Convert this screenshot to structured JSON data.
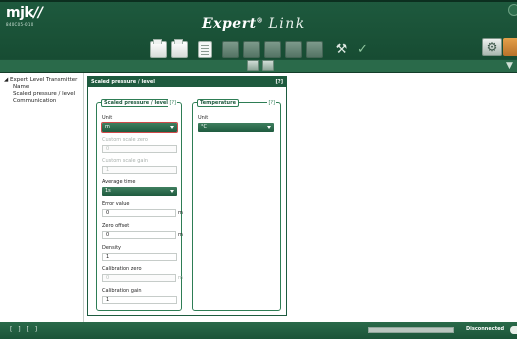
{
  "app": {
    "logo_text": "mjk",
    "logo_sub": "840C05-010",
    "title_main": "Expert",
    "title_sup": "®",
    "title_link": "Link"
  },
  "nav": {
    "root": "Expert Level Transmitter",
    "items": [
      "Name",
      "Scaled pressure / level",
      "Communication"
    ]
  },
  "panel": {
    "title": "Scaled pressure / level",
    "help": "[?]"
  },
  "scaled": {
    "group_title": "Scaled pressure / level",
    "help": "[?]",
    "unit_label": "Unit",
    "unit_value": "m",
    "custom_zero_label": "Custom scale zero",
    "custom_zero_value": "0",
    "custom_gain_label": "Custom scale gain",
    "custom_gain_value": "1",
    "avg_label": "Average time",
    "avg_value": "1s",
    "error_label": "Error value",
    "error_value": "0",
    "error_unit": "m",
    "zero_label": "Zero offset",
    "zero_value": "0",
    "zero_unit": "m",
    "density_label": "Density",
    "density_value": "1",
    "cal_zero_label": "Calibration zero",
    "cal_zero_value": "0",
    "cal_zero_unit": "m",
    "cal_gain_label": "Calibration gain",
    "cal_gain_value": "1"
  },
  "temperature": {
    "group_title": "Temperature",
    "help": "[?]",
    "unit_label": "Unit",
    "unit_value": "°C"
  },
  "status": {
    "left": "[ ] [ ]",
    "connection": "Disconnected"
  }
}
